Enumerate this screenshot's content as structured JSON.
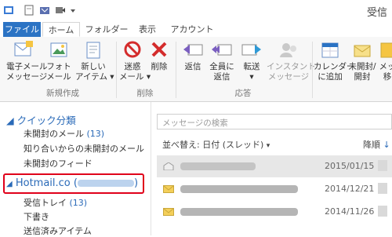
{
  "window": {
    "title": "受信"
  },
  "qat": {
    "icons": [
      "outlook-app-icon",
      "new-item-icon",
      "undo-icon",
      "send-receive-icon",
      "customize-qat-icon"
    ]
  },
  "tabs": [
    {
      "label": "ファイル"
    },
    {
      "label": "ホーム"
    },
    {
      "label": "フォルダー"
    },
    {
      "label": "表示"
    },
    {
      "label": "アカウント"
    }
  ],
  "ribbon": {
    "new_email": "電子メール\nメッセージ",
    "new_photo": "フォト\nメール",
    "new_items": "新しい\nアイテム ▾",
    "group_new": "新規作成",
    "junk": "迷惑\nメール ▾",
    "delete": "削除",
    "group_delete": "削除",
    "reply": "返信",
    "reply_all": "全員に\n返信",
    "forward": "転送\n▾",
    "im": "インスタント\nメッセージ",
    "group_respond": "応答",
    "add_calendar": "カレンダー\nに追加",
    "unread_read": "未開封/\n開封",
    "move": "メッ\n移"
  },
  "nav": {
    "quick_views": "クイック分類",
    "unread_label": "未開封のメール",
    "unread_count": "(13)",
    "contacts_unread": "知り合いからの未開封のメール",
    "unread_feeds": "未開封のフィード",
    "account_prefix": "Hotmail.co",
    "account_paren_open": "(",
    "account_paren_close": ")",
    "inbox_label": "受信トレイ",
    "inbox_count": "(13)",
    "drafts": "下書き",
    "sent": "送信済みアイテム"
  },
  "list": {
    "search_placeholder": "メッセージの検索",
    "sort_label": "並べ替え: 日付 (スレッド)",
    "sort_caret": "▾",
    "order_label": "降順",
    "order_arrow": "↓",
    "rows": [
      {
        "date": "2015/01/15",
        "read": true
      },
      {
        "date": "2014/12/21",
        "read": false
      },
      {
        "date": "2014/11/26",
        "read": false
      }
    ]
  },
  "colors": {
    "accent": "#2b73c4",
    "link": "#2a6ab8",
    "highlight": "#e0001a"
  }
}
